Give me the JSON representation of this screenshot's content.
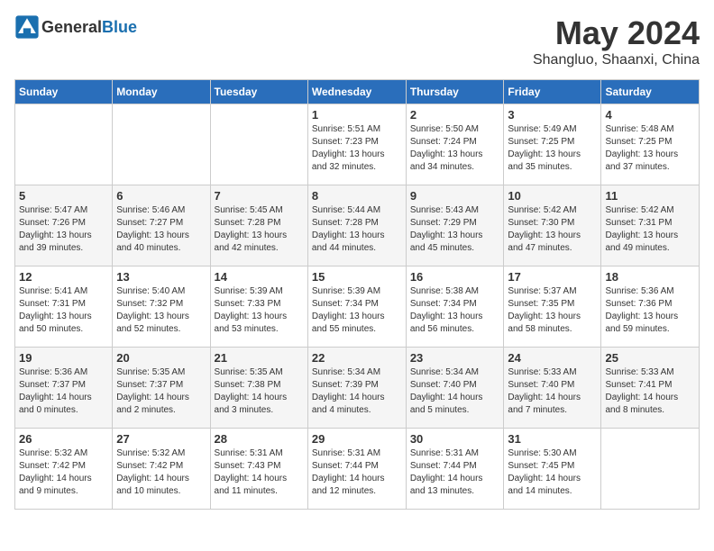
{
  "logo": {
    "text_general": "General",
    "text_blue": "Blue"
  },
  "title": "May 2024",
  "subtitle": "Shangluo, Shaanxi, China",
  "days_of_week": [
    "Sunday",
    "Monday",
    "Tuesday",
    "Wednesday",
    "Thursday",
    "Friday",
    "Saturday"
  ],
  "weeks": [
    [
      {
        "day": "",
        "info": ""
      },
      {
        "day": "",
        "info": ""
      },
      {
        "day": "",
        "info": ""
      },
      {
        "day": "1",
        "info": "Sunrise: 5:51 AM\nSunset: 7:23 PM\nDaylight: 13 hours and 32 minutes."
      },
      {
        "day": "2",
        "info": "Sunrise: 5:50 AM\nSunset: 7:24 PM\nDaylight: 13 hours and 34 minutes."
      },
      {
        "day": "3",
        "info": "Sunrise: 5:49 AM\nSunset: 7:25 PM\nDaylight: 13 hours and 35 minutes."
      },
      {
        "day": "4",
        "info": "Sunrise: 5:48 AM\nSunset: 7:25 PM\nDaylight: 13 hours and 37 minutes."
      }
    ],
    [
      {
        "day": "5",
        "info": "Sunrise: 5:47 AM\nSunset: 7:26 PM\nDaylight: 13 hours and 39 minutes."
      },
      {
        "day": "6",
        "info": "Sunrise: 5:46 AM\nSunset: 7:27 PM\nDaylight: 13 hours and 40 minutes."
      },
      {
        "day": "7",
        "info": "Sunrise: 5:45 AM\nSunset: 7:28 PM\nDaylight: 13 hours and 42 minutes."
      },
      {
        "day": "8",
        "info": "Sunrise: 5:44 AM\nSunset: 7:28 PM\nDaylight: 13 hours and 44 minutes."
      },
      {
        "day": "9",
        "info": "Sunrise: 5:43 AM\nSunset: 7:29 PM\nDaylight: 13 hours and 45 minutes."
      },
      {
        "day": "10",
        "info": "Sunrise: 5:42 AM\nSunset: 7:30 PM\nDaylight: 13 hours and 47 minutes."
      },
      {
        "day": "11",
        "info": "Sunrise: 5:42 AM\nSunset: 7:31 PM\nDaylight: 13 hours and 49 minutes."
      }
    ],
    [
      {
        "day": "12",
        "info": "Sunrise: 5:41 AM\nSunset: 7:31 PM\nDaylight: 13 hours and 50 minutes."
      },
      {
        "day": "13",
        "info": "Sunrise: 5:40 AM\nSunset: 7:32 PM\nDaylight: 13 hours and 52 minutes."
      },
      {
        "day": "14",
        "info": "Sunrise: 5:39 AM\nSunset: 7:33 PM\nDaylight: 13 hours and 53 minutes."
      },
      {
        "day": "15",
        "info": "Sunrise: 5:39 AM\nSunset: 7:34 PM\nDaylight: 13 hours and 55 minutes."
      },
      {
        "day": "16",
        "info": "Sunrise: 5:38 AM\nSunset: 7:34 PM\nDaylight: 13 hours and 56 minutes."
      },
      {
        "day": "17",
        "info": "Sunrise: 5:37 AM\nSunset: 7:35 PM\nDaylight: 13 hours and 58 minutes."
      },
      {
        "day": "18",
        "info": "Sunrise: 5:36 AM\nSunset: 7:36 PM\nDaylight: 13 hours and 59 minutes."
      }
    ],
    [
      {
        "day": "19",
        "info": "Sunrise: 5:36 AM\nSunset: 7:37 PM\nDaylight: 14 hours and 0 minutes."
      },
      {
        "day": "20",
        "info": "Sunrise: 5:35 AM\nSunset: 7:37 PM\nDaylight: 14 hours and 2 minutes."
      },
      {
        "day": "21",
        "info": "Sunrise: 5:35 AM\nSunset: 7:38 PM\nDaylight: 14 hours and 3 minutes."
      },
      {
        "day": "22",
        "info": "Sunrise: 5:34 AM\nSunset: 7:39 PM\nDaylight: 14 hours and 4 minutes."
      },
      {
        "day": "23",
        "info": "Sunrise: 5:34 AM\nSunset: 7:40 PM\nDaylight: 14 hours and 5 minutes."
      },
      {
        "day": "24",
        "info": "Sunrise: 5:33 AM\nSunset: 7:40 PM\nDaylight: 14 hours and 7 minutes."
      },
      {
        "day": "25",
        "info": "Sunrise: 5:33 AM\nSunset: 7:41 PM\nDaylight: 14 hours and 8 minutes."
      }
    ],
    [
      {
        "day": "26",
        "info": "Sunrise: 5:32 AM\nSunset: 7:42 PM\nDaylight: 14 hours and 9 minutes."
      },
      {
        "day": "27",
        "info": "Sunrise: 5:32 AM\nSunset: 7:42 PM\nDaylight: 14 hours and 10 minutes."
      },
      {
        "day": "28",
        "info": "Sunrise: 5:31 AM\nSunset: 7:43 PM\nDaylight: 14 hours and 11 minutes."
      },
      {
        "day": "29",
        "info": "Sunrise: 5:31 AM\nSunset: 7:44 PM\nDaylight: 14 hours and 12 minutes."
      },
      {
        "day": "30",
        "info": "Sunrise: 5:31 AM\nSunset: 7:44 PM\nDaylight: 14 hours and 13 minutes."
      },
      {
        "day": "31",
        "info": "Sunrise: 5:30 AM\nSunset: 7:45 PM\nDaylight: 14 hours and 14 minutes."
      },
      {
        "day": "",
        "info": ""
      }
    ]
  ]
}
